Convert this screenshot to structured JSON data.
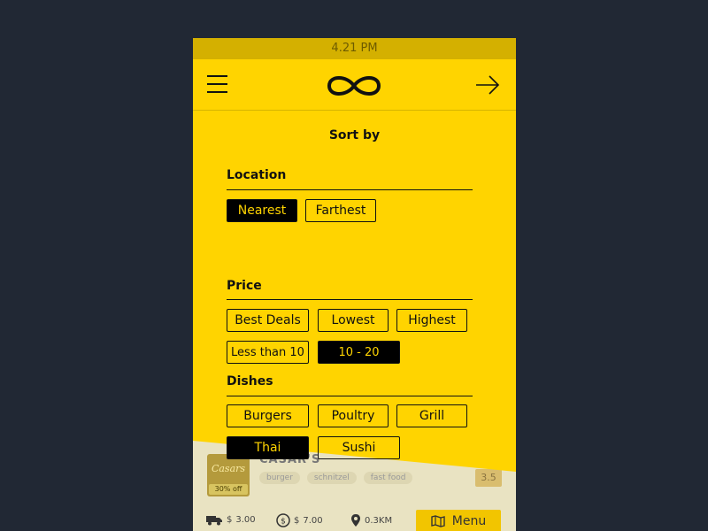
{
  "status_bar": {
    "time": "4.21 PM"
  },
  "nav": {
    "menu_icon": "hamburger-icon",
    "logo_icon": "infinity-icon",
    "action_icon": "arrow-right-icon"
  },
  "sort": {
    "title": "Sort by",
    "location": {
      "label": "Location",
      "options": [
        "Nearest",
        "Farthest"
      ],
      "selected": "Nearest"
    },
    "price": {
      "label": "Price",
      "options": [
        "Best Deals",
        "Lowest",
        "Highest",
        "Less than 10",
        "10 - 20"
      ],
      "selected": "10 - 20"
    },
    "dishes": {
      "label": "Dishes",
      "options": [
        "Burgers",
        "Poultry",
        "Grill",
        "Thai",
        "Sushi"
      ],
      "selected": "Thai"
    }
  },
  "restaurant": {
    "name": "CASAR'S",
    "thumb_brand": "Casars",
    "offer": "30% off",
    "tags": [
      "burger",
      "schnitzel",
      "fast food"
    ],
    "rating": "3.5",
    "delivery_fee": "3.00",
    "min_order": "7.00",
    "distance": "0.3KM",
    "menu_label": "Menu"
  },
  "colors": {
    "accent": "#ffd400",
    "background": "#212834",
    "chip_active": "#000000"
  }
}
